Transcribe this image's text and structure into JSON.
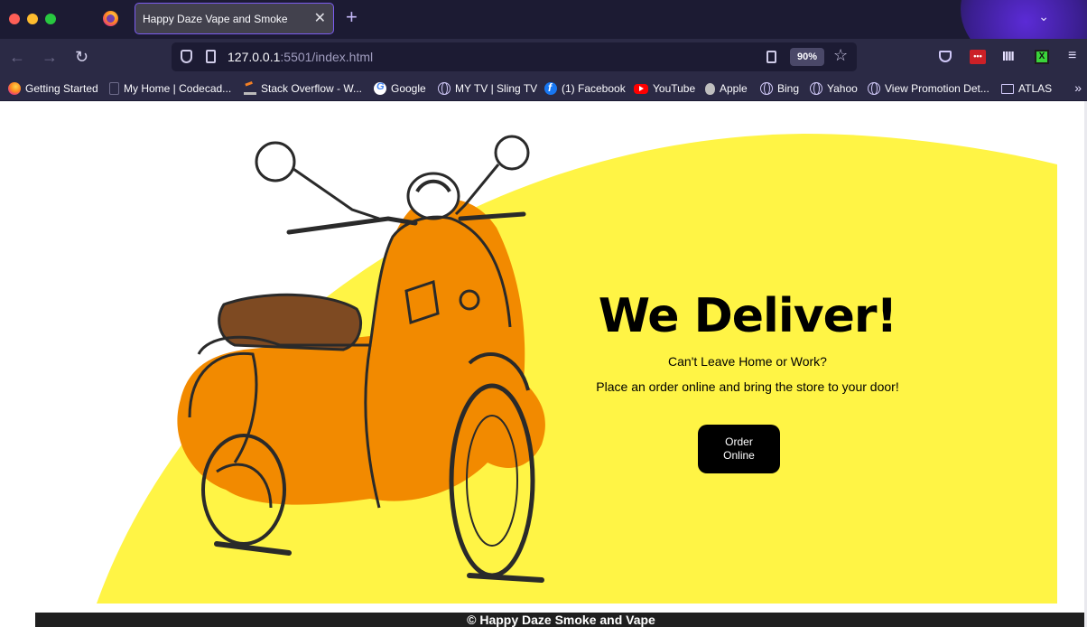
{
  "browser": {
    "tab": {
      "title": "Happy Daze Vape and Smoke",
      "close_glyph": "✕"
    },
    "new_tab_glyph": "+",
    "list_tabs_glyph": "⌄",
    "nav": {
      "back_glyph": "←",
      "forward_glyph": "→",
      "reload_glyph": "↻"
    },
    "url": {
      "host": "127.0.0.1",
      "rest": ":5501/index.html"
    },
    "zoom": "90%",
    "star_glyph": "☆",
    "lastpass_glyph": "•••",
    "fence_glyph": "IIII",
    "ext_x_glyph": "X",
    "menu_glyph": "≡",
    "bookmarks": [
      {
        "label": "Getting Started",
        "icon": "firefox-icon"
      },
      {
        "label": "My Home | Codecad...",
        "icon": "page-icon"
      },
      {
        "label": "Stack Overflow - W...",
        "icon": "stackoverflow-icon"
      },
      {
        "label": "Google",
        "icon": "google-icon"
      },
      {
        "label": "MY TV | Sling TV",
        "icon": "globe-icon"
      },
      {
        "label": "(1) Facebook",
        "icon": "facebook-icon"
      },
      {
        "label": "YouTube",
        "icon": "youtube-icon"
      },
      {
        "label": "Apple",
        "icon": "apple-icon"
      },
      {
        "label": "Bing",
        "icon": "globe-icon"
      },
      {
        "label": "Yahoo",
        "icon": "globe-icon"
      },
      {
        "label": "View Promotion Det...",
        "icon": "globe-icon"
      },
      {
        "label": "ATLAS",
        "icon": "folder-icon"
      }
    ],
    "bookmarks_more_glyph": "»"
  },
  "hero": {
    "title": "We Deliver!",
    "subtitle": "Can't Leave Home or Work?",
    "tagline": "Place an order online and bring the store to your door!",
    "button_line1": "Order",
    "button_line2": "Online"
  },
  "footer": {
    "text": "© Happy Daze Smoke and Vape"
  },
  "colors": {
    "accent_yellow": "#fff445",
    "scooter_orange": "#f28a00",
    "seat_brown": "#7e4a22",
    "browser_tab_bg": "#1c1b33",
    "browser_toolbar_bg": "#2b2a45",
    "button_bg": "#000000"
  }
}
